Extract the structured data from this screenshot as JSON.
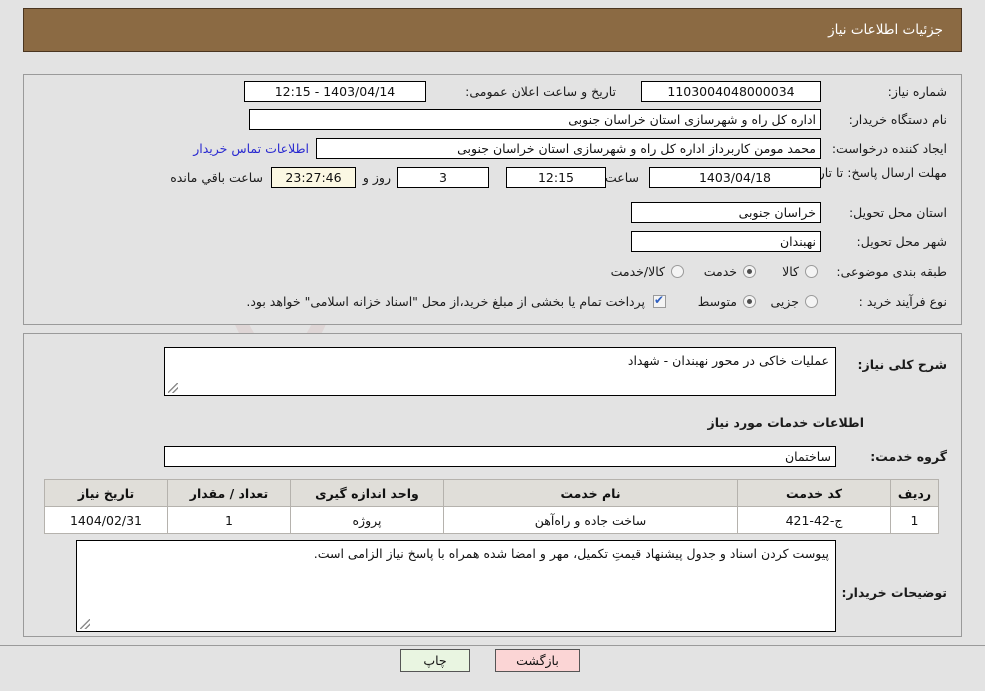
{
  "header": {
    "title": "جزئیات اطلاعات نیاز"
  },
  "main": {
    "need_number_label": "شماره نیاز:",
    "need_number_value": "1103004048000034",
    "announce_label": "تاریخ و ساعت اعلان عمومی:",
    "announce_value": "1403/04/14 - 12:15",
    "buyer_org_label": "نام دستگاه خریدار:",
    "buyer_org_value": "اداره کل راه و شهرسازی استان خراسان جنوبی",
    "creator_label": "ایجاد کننده درخواست:",
    "creator_value": "محمد مومن کاربرداز اداره کل راه و شهرسازی استان خراسان جنوبی",
    "contact_link": "اطلاعات تماس خریدار",
    "deadline_label": "مهلت ارسال پاسخ: تا تاریخ:",
    "deadline_date": "1403/04/18",
    "hour_label": "ساعت",
    "deadline_time": "12:15",
    "days_remaining": "3",
    "days_word": "روز و",
    "countdown": "23:27:46",
    "countdown_suffix": "ساعت باقي مانده",
    "province_label": "استان محل تحویل:",
    "province_value": "خراسان جنوبی",
    "city_label": "شهر محل تحویل:",
    "city_value": "نهبندان",
    "category_label": "طبقه بندی موضوعی:",
    "category_options": [
      {
        "label": "کالا",
        "selected": false
      },
      {
        "label": "خدمت",
        "selected": true
      },
      {
        "label": "کالا/خدمت",
        "selected": false
      }
    ],
    "process_label": "نوع فرآیند خرید :",
    "process_options": [
      {
        "label": "جزیی",
        "selected": false
      },
      {
        "label": "متوسط",
        "selected": true
      }
    ],
    "treasury_checkbox_checked": true,
    "treasury_text": "پرداخت تمام یا بخشی از مبلغ خرید،از محل \"اسناد خزانه اسلامی\" خواهد بود."
  },
  "detail": {
    "summary_label": "شرح کلی نیاز:",
    "summary_value": "عملیات خاکی در محور نهبندان - شهداد",
    "services_section_title": "اطلاعات خدمات مورد نیاز",
    "service_group_label": "گروه خدمت:",
    "service_group_value": "ساختمان",
    "table": {
      "columns": [
        "ردیف",
        "کد خدمت",
        "نام خدمت",
        "واحد اندازه گیری",
        "تعداد / مقدار",
        "تاریخ نیاز"
      ],
      "rows": [
        [
          "1",
          "ج-42-421",
          "ساخت جاده و راه‌آهن",
          "پروژه",
          "1",
          "1404/02/31"
        ]
      ]
    },
    "buyer_notes_label": "توضیحات خریدار:",
    "buyer_notes_value": "پیوست کردن اسناد و جدول پیشنهاد قیمتِ تکمیل، مهر و امضا شده همراه با پاسخ نیاز الزامی است."
  },
  "footer": {
    "print_label": "چاپ",
    "back_label": "بازگشت"
  },
  "colors": {
    "header_bg": "#8b6a43",
    "page_bg": "#e3e3e3",
    "link": "#2a2ad0",
    "print_btn": "#e9f5e1",
    "back_btn": "#fbd5d5",
    "countdown_bg": "#fbf8e3",
    "table_header_bg": "#e0ded9"
  }
}
